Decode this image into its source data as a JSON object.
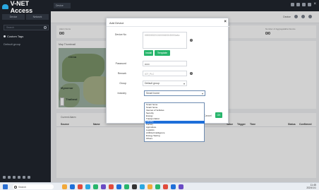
{
  "app": {
    "title": "V-NET Access"
  },
  "sidebar": {
    "tabs": [
      "Device",
      "Network"
    ],
    "search_placeholder": "Search",
    "items": [
      {
        "label": "Custom Tags"
      },
      {
        "label": "Default group"
      }
    ]
  },
  "topbar": {
    "tab_label": "Device"
  },
  "subbar": {
    "left": "",
    "right_label": "Device"
  },
  "stats": {
    "items": [
      {
        "label": "Alarm Items",
        "value": "0/0"
      },
      {
        "label": "Number of Aggregatable Device",
        "value": "0/0"
      }
    ]
  },
  "map_panel": {
    "title": "Map Thumbnail",
    "labels": [
      "China",
      "Thailand",
      "Myanmar"
    ]
  },
  "table": {
    "title": "Current Alarm",
    "columns": [
      "Source",
      "Name",
      "Value",
      "Trigger",
      "Time",
      "Status",
      "Confirmed"
    ]
  },
  "modal": {
    "title": "Add Device",
    "close": "×",
    "fields": {
      "device_no_label": "Device No",
      "device_no_placeholder": "0000000221010001600130001abc",
      "password_label": "Password",
      "password_value": "••••••",
      "remark_label": "Remark",
      "remark_placeholder": "IOT_PLC",
      "group_label": "Group",
      "group_value": "Default group",
      "industry_label": "Industry",
      "industry_value": "Smart home"
    },
    "buttons": {
      "install": "Install",
      "template": "Template",
      "cancel": "Cancel",
      "ok": "OK"
    },
    "help": "?",
    "caret": "▾"
  },
  "industry_options": [
    "Smart home",
    "Smart home",
    "Internet of Vehicles",
    "Security",
    "Energy",
    "Transportation",
    "Industry",
    "Factory",
    "Agriculture",
    "Logistics",
    "Artificial Intelligence",
    "Energy Saving",
    "Others"
  ],
  "taskbar": {
    "search": "Search",
    "time": "11:45",
    "date": "2024/1/1",
    "app_colors": [
      "#f2a93b",
      "#1e6fd9",
      "#e04b3c",
      "#2aa7e0",
      "#27b56b",
      "#6a4bc4",
      "#e04b3c",
      "#1e6fd9",
      "#27b56b",
      "#333333",
      "#2aa7e0",
      "#f2a93b",
      "#27b56b",
      "#e04b3c",
      "#1e6fd9",
      "#6a4bc4"
    ]
  },
  "colors": {
    "accent_green": "#27b56b",
    "selection": "#1e6fd9",
    "brand_blue": "#2aa7e0"
  }
}
